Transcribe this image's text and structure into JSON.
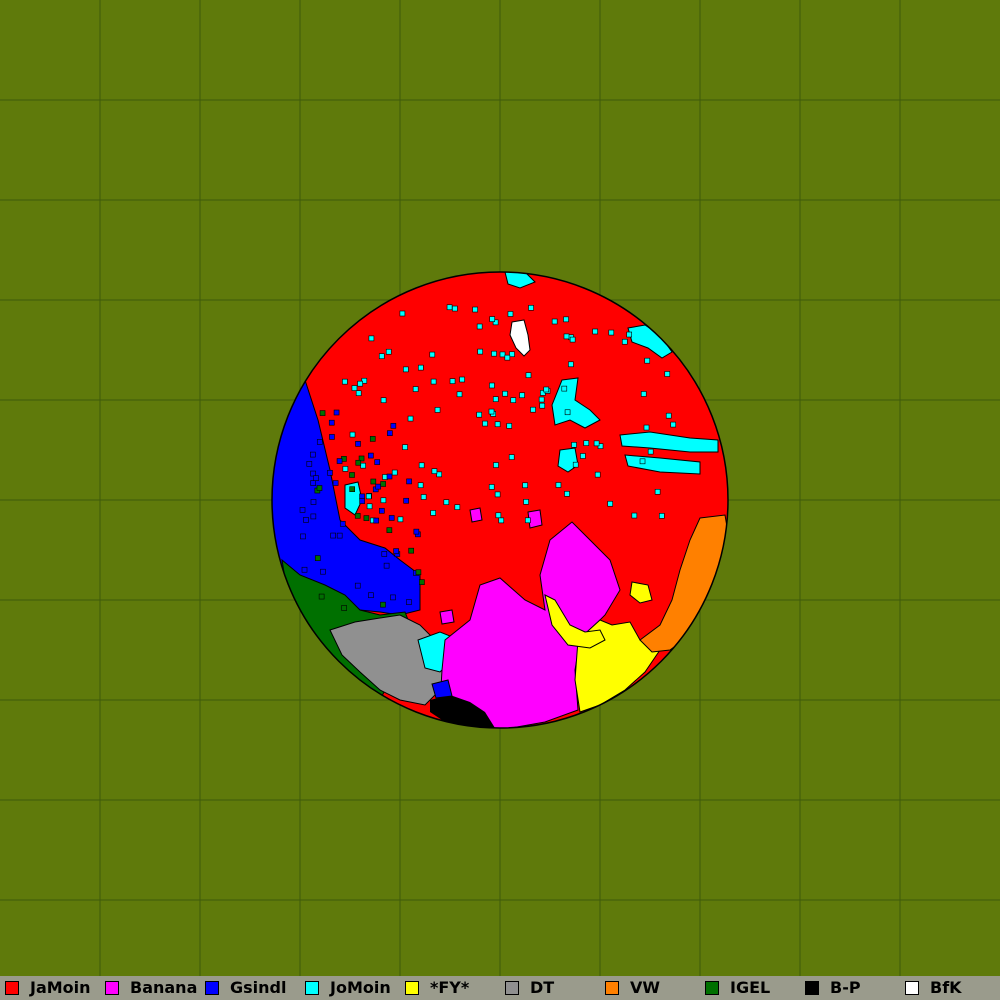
{
  "map": {
    "background_color": "#5f7a0b",
    "grid_line_color": "#3e5a0b",
    "grid_columns": 10,
    "grid_rows": 10
  },
  "players": [
    {
      "name": "JaMoin",
      "color": "#ff0000"
    },
    {
      "name": "Banana",
      "color": "#ff00ff"
    },
    {
      "name": "Gsindl",
      "color": "#0000ff"
    },
    {
      "name": "JoMoin",
      "color": "#00ffff"
    },
    {
      "name": "*FY*",
      "color": "#ffff00"
    },
    {
      "name": "DT",
      "color": "#909090"
    },
    {
      "name": "VW",
      "color": "#ff8000"
    },
    {
      "name": "IGEL",
      "color": "#007000"
    },
    {
      "name": "B-P",
      "color": "#000000"
    },
    {
      "name": "BfK",
      "color": "#ffffff"
    }
  ]
}
